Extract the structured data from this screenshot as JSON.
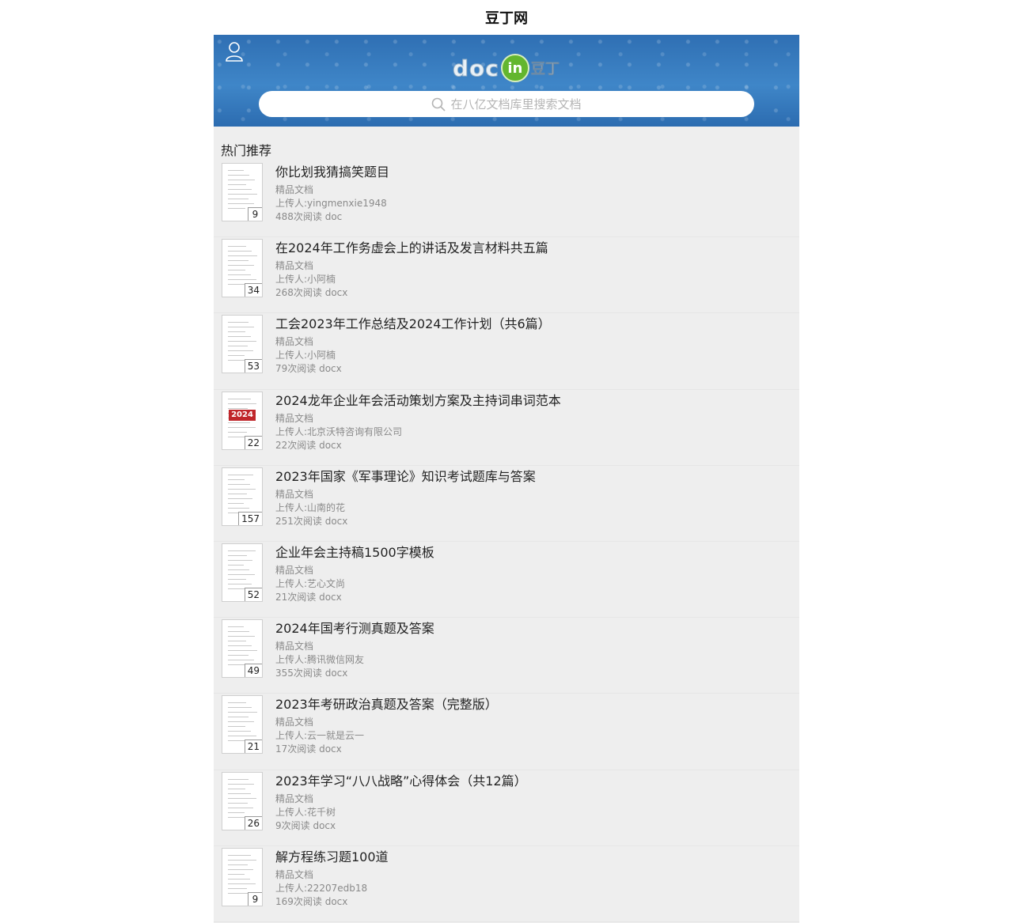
{
  "site_title": "豆丁网",
  "header": {
    "logo_doc": "doc",
    "logo_in": "in",
    "logo_cn": "豆丁",
    "search_placeholder": "在八亿文档库里搜索文档"
  },
  "section_title": "热门推荐",
  "items": [
    {
      "title": "你比划我猜搞笑题目",
      "tag": "精品文档",
      "uploader": "上传人:yingmenxie1948",
      "stats": "488次阅读 doc",
      "pages": "9"
    },
    {
      "title": "在2024年工作务虚会上的讲话及发言材料共五篇",
      "tag": "精品文档",
      "uploader": "上传人:小阿楠",
      "stats": "268次阅读 docx",
      "pages": "34"
    },
    {
      "title": "工会2023年工作总结及2024工作计划（共6篇）",
      "tag": "精品文档",
      "uploader": "上传人:小阿楠",
      "stats": "79次阅读 docx",
      "pages": "53"
    },
    {
      "title": "2024龙年企业年会活动策划方案及主持词串词范本",
      "tag": "精品文档",
      "uploader": "上传人:北京沃特咨询有限公司",
      "stats": "22次阅读 docx",
      "pages": "22",
      "thumb_badge": "2024"
    },
    {
      "title": "2023年国家《军事理论》知识考试题库与答案",
      "tag": "精品文档",
      "uploader": "上传人:山南的花",
      "stats": "251次阅读 docx",
      "pages": "157"
    },
    {
      "title": "企业年会主持稿1500字模板",
      "tag": "精品文档",
      "uploader": "上传人:艺心文尚",
      "stats": "21次阅读 docx",
      "pages": "52"
    },
    {
      "title": "2024年国考行测真题及答案",
      "tag": "精品文档",
      "uploader": "上传人:腾讯微信网友",
      "stats": "355次阅读 docx",
      "pages": "49"
    },
    {
      "title": "2023年考研政治真题及答案（完整版）",
      "tag": "精品文档",
      "uploader": "上传人:云一就是云一",
      "stats": "17次阅读 docx",
      "pages": "21"
    },
    {
      "title": "2023年学习“八八战略”心得体会（共12篇）",
      "tag": "精品文档",
      "uploader": "上传人:花千树",
      "stats": "9次阅读 docx",
      "pages": "26"
    },
    {
      "title": "解方程练习题100道",
      "tag": "精品文档",
      "uploader": "上传人:22207edb18",
      "stats": "169次阅读 docx",
      "pages": "9"
    }
  ],
  "colors": {
    "banner": "#3f86c8",
    "logo_green": "#63b62f",
    "background": "#eeeeee"
  }
}
